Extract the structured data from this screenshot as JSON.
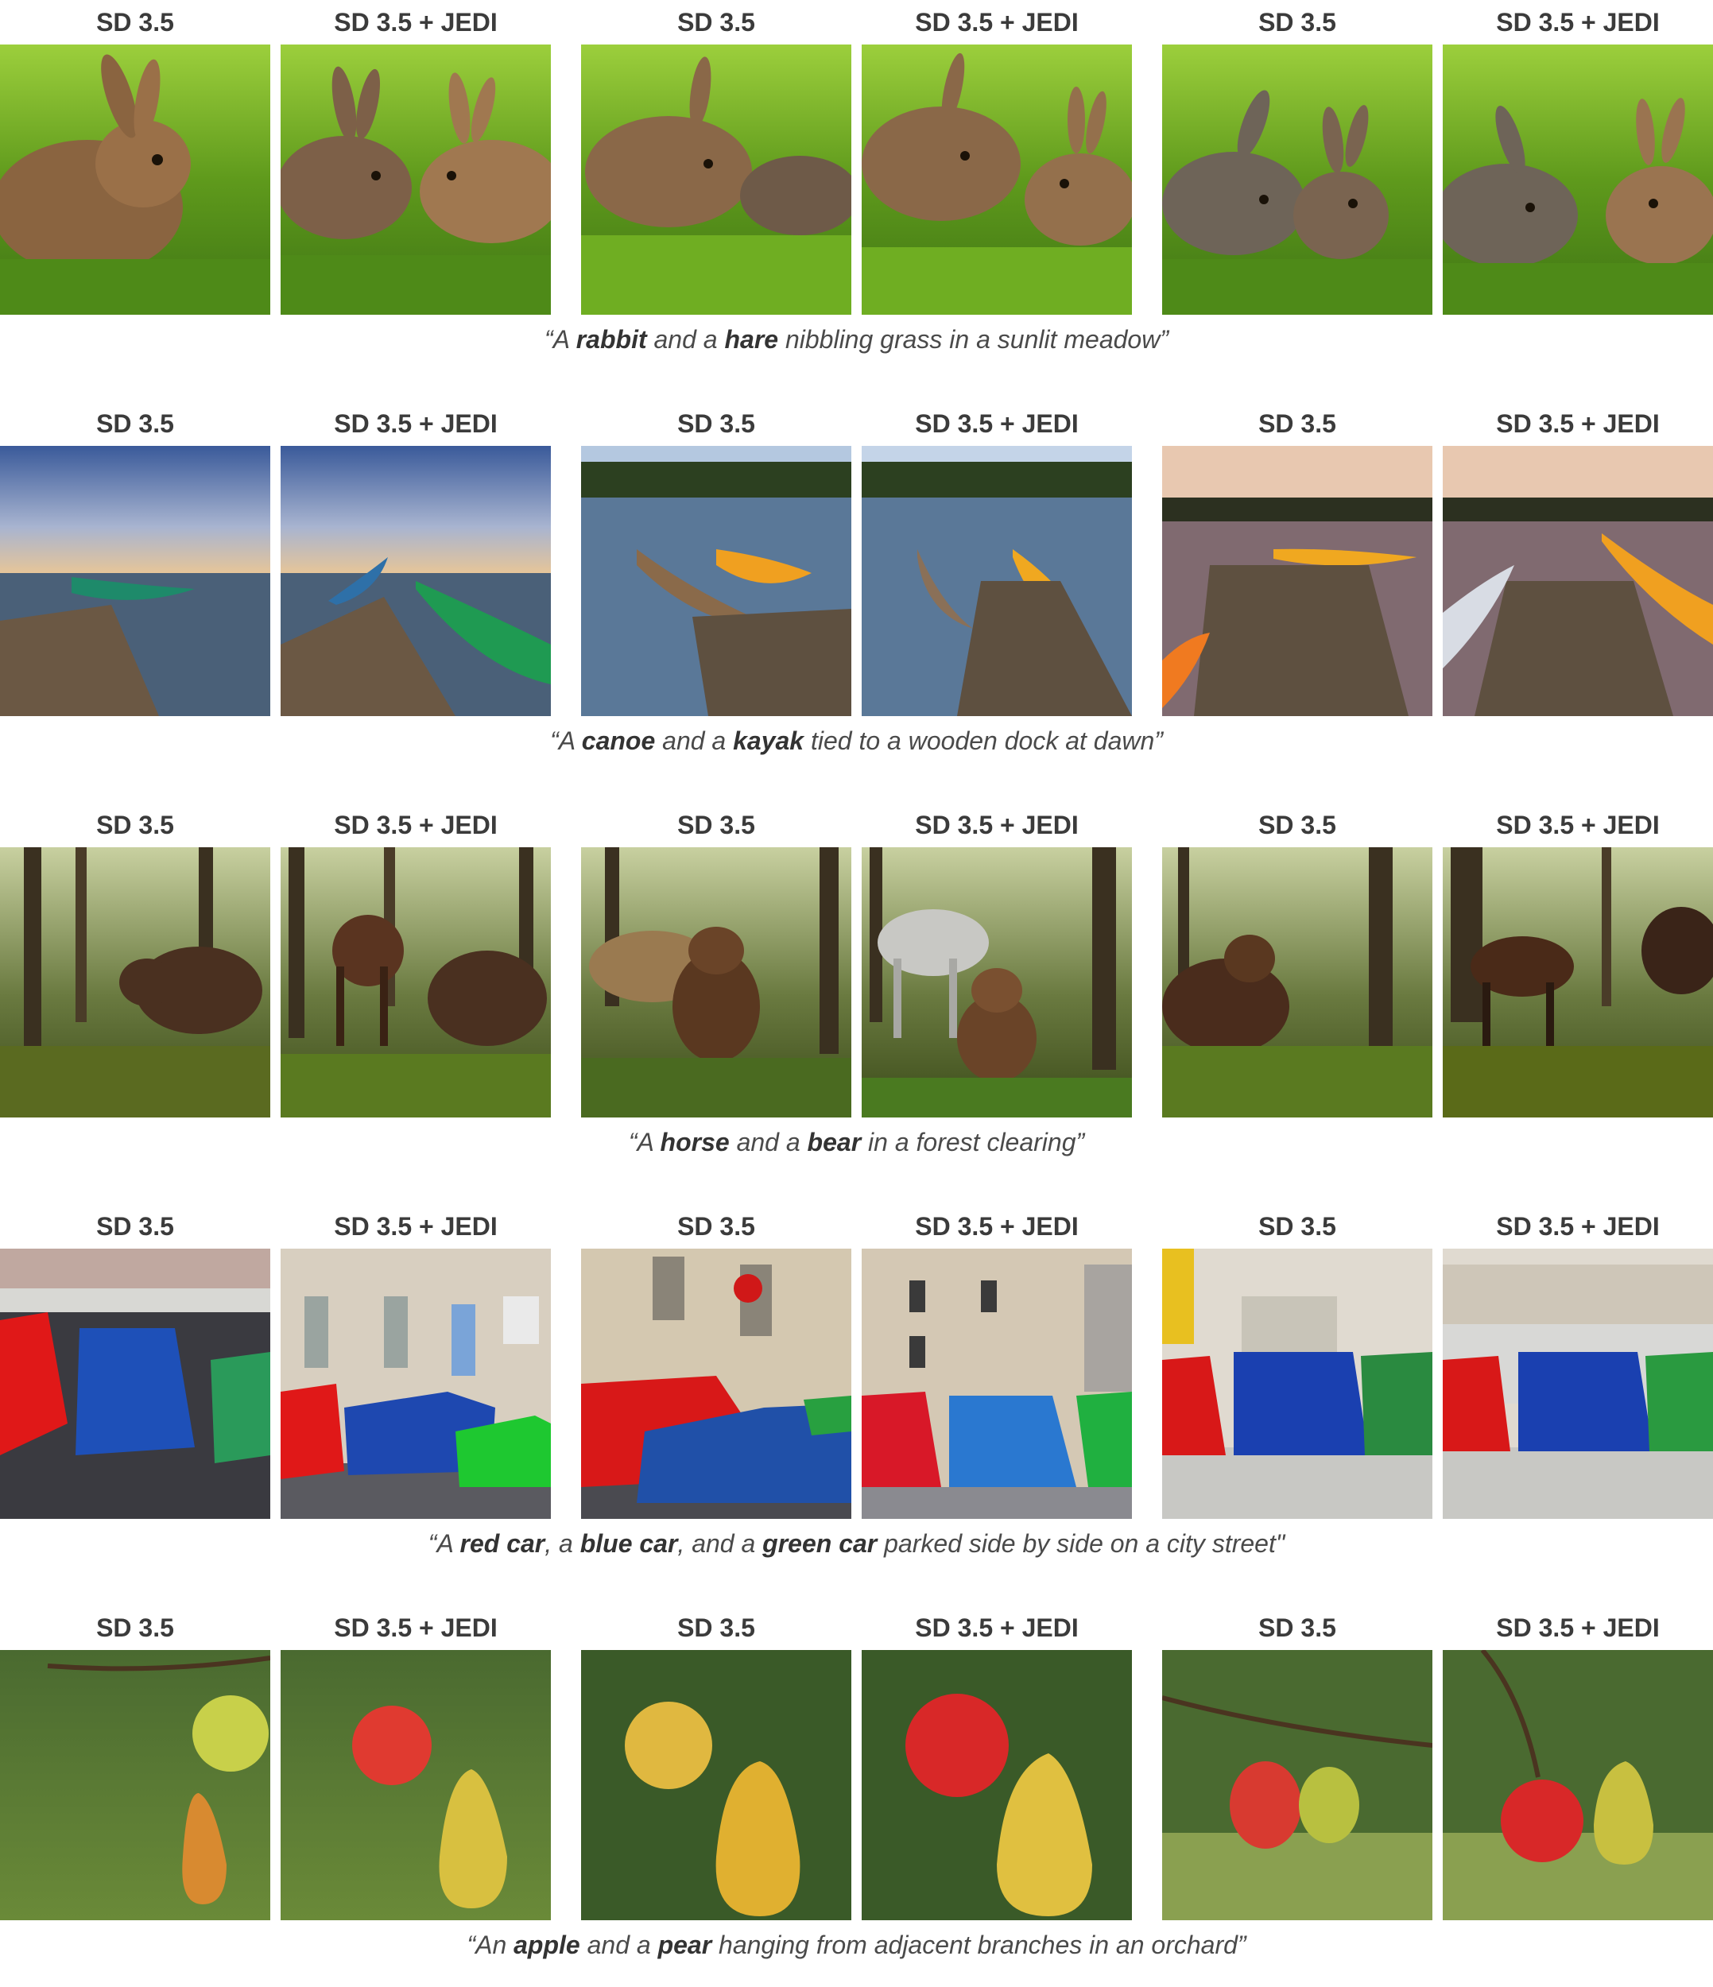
{
  "rows": [
    {
      "labels": [
        "SD 3.5",
        "SD 3.5 + JEDI",
        "SD 3.5",
        "SD 3.5 + JEDI",
        "SD 3.5",
        "SD 3.5 + JEDI"
      ],
      "caption": [
        {
          "t": "“A ",
          "b": false
        },
        {
          "t": "rabbit",
          "b": true
        },
        {
          "t": " and a ",
          "b": false
        },
        {
          "t": "hare",
          "b": true
        },
        {
          "t": " nibbling grass in a sunlit meadow”",
          "b": false
        }
      ]
    },
    {
      "labels": [
        "SD 3.5",
        "SD 3.5 + JEDI",
        "SD 3.5",
        "SD 3.5 + JEDI",
        "SD 3.5",
        "SD 3.5 + JEDI"
      ],
      "caption": [
        {
          "t": "“A ",
          "b": false
        },
        {
          "t": "canoe",
          "b": true
        },
        {
          "t": " and a ",
          "b": false
        },
        {
          "t": "kayak",
          "b": true
        },
        {
          "t": " tied to a wooden dock at dawn”",
          "b": false
        }
      ]
    },
    {
      "labels": [
        "SD 3.5",
        "SD 3.5 + JEDI",
        "SD 3.5",
        "SD 3.5 + JEDI",
        "SD 3.5",
        "SD 3.5 + JEDI"
      ],
      "caption": [
        {
          "t": "“A ",
          "b": false
        },
        {
          "t": "horse",
          "b": true
        },
        {
          "t": " and a ",
          "b": false
        },
        {
          "t": "bear",
          "b": true
        },
        {
          "t": " in a forest clearing”",
          "b": false
        }
      ]
    },
    {
      "labels": [
        "SD 3.5",
        "SD 3.5 + JEDI",
        "SD 3.5",
        "SD 3.5 + JEDI",
        "SD 3.5",
        "SD 3.5 + JEDI"
      ],
      "caption": [
        {
          "t": "“A ",
          "b": false
        },
        {
          "t": "red car",
          "b": true
        },
        {
          "t": ", a ",
          "b": false
        },
        {
          "t": "blue car",
          "b": true
        },
        {
          "t": ", and a ",
          "b": false
        },
        {
          "t": "green car",
          "b": true
        },
        {
          "t": " parked side by side on a city street\"",
          "b": false
        }
      ]
    },
    {
      "labels": [
        "SD 3.5",
        "SD 3.5 + JEDI",
        "SD 3.5",
        "SD 3.5 + JEDI",
        "SD 3.5",
        "SD 3.5 + JEDI"
      ],
      "caption": [
        {
          "t": "“An ",
          "b": false
        },
        {
          "t": "apple",
          "b": true
        },
        {
          "t": " and a ",
          "b": false
        },
        {
          "t": "pear",
          "b": true
        },
        {
          "t": " hanging from adjacent branches in an orchard”",
          "b": false
        }
      ]
    }
  ]
}
